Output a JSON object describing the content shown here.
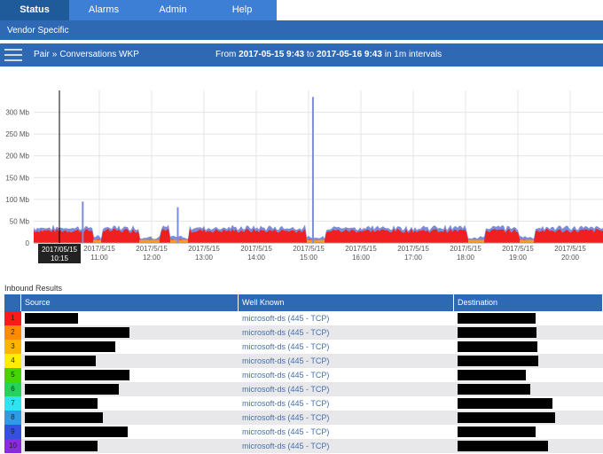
{
  "nav": {
    "tabs": [
      {
        "label": "Status",
        "active": true
      },
      {
        "label": "Alarms",
        "active": false
      },
      {
        "label": "Admin",
        "active": false
      },
      {
        "label": "Help",
        "active": false
      }
    ]
  },
  "vendor_bar": {
    "label": "Vendor Specific"
  },
  "path_bar": {
    "crumb_1": "Pair",
    "separator": "»",
    "crumb_2": "Conversations WKP",
    "range_from_prefix": "From",
    "range_from": "2017-05-15 9:43",
    "range_to_prefix": "to",
    "range_to": "2017-05-16 9:43",
    "range_interval": "in 1m intervals"
  },
  "chart_data": {
    "type": "area",
    "title": "",
    "xlabel": "",
    "ylabel": "",
    "y_unit": "Mb",
    "ylim": [
      0,
      350
    ],
    "y_ticks": [
      0,
      50,
      100,
      150,
      200,
      250,
      300
    ],
    "y_tick_labels": [
      "0",
      "50 Mb",
      "100 Mb",
      "150 Mb",
      "200 Mb",
      "250 Mb",
      "300 Mb"
    ],
    "x_ticks": [
      {
        "date": "2017/5/15",
        "time": "11:00"
      },
      {
        "date": "2017/5/15",
        "time": "12:00"
      },
      {
        "date": "2017/5/15",
        "time": "13:00"
      },
      {
        "date": "2017/5/15",
        "time": "14:00"
      },
      {
        "date": "2017/5/15",
        "time": "15:00"
      },
      {
        "date": "2017/5/15",
        "time": "16:00"
      },
      {
        "date": "2017/5/15",
        "time": "17:00"
      },
      {
        "date": "2017/5/15",
        "time": "18:00"
      },
      {
        "date": "2017/5/15",
        "time": "19:00"
      },
      {
        "date": "2017/5/15",
        "time": "20:00"
      }
    ],
    "cursor_label": {
      "date": "2017/05/15",
      "time": "10:15"
    },
    "grid": true,
    "series_colors": [
      "#f02020",
      "#ff9a1a",
      "#e8c000",
      "#3aa0e0",
      "#7c8cd8"
    ],
    "base_value_approx": 28,
    "spikes": [
      {
        "time": "10:41",
        "value": 95
      },
      {
        "time": "12:30",
        "value": 82
      },
      {
        "time": "15:05",
        "value": 335
      }
    ]
  },
  "results": {
    "title": "Inbound Results",
    "columns": [
      "Source",
      "Well Known",
      "Destination"
    ],
    "rows": [
      {
        "rank": "1",
        "color": "#ff1a1a",
        "well_known": "microsoft-ds (445 - TCP)"
      },
      {
        "rank": "2",
        "color": "#ff8a00",
        "well_known": "microsoft-ds (445 - TCP)"
      },
      {
        "rank": "3",
        "color": "#ffb400",
        "well_known": "microsoft-ds (445 - TCP)"
      },
      {
        "rank": "4",
        "color": "#ffee00",
        "well_known": "microsoft-ds (445 - TCP)"
      },
      {
        "rank": "5",
        "color": "#44d400",
        "well_known": "microsoft-ds (445 - TCP)"
      },
      {
        "rank": "6",
        "color": "#27d25a",
        "well_known": "microsoft-ds (445 - TCP)"
      },
      {
        "rank": "7",
        "color": "#2fe4f0",
        "well_known": "microsoft-ds (445 - TCP)"
      },
      {
        "rank": "8",
        "color": "#2f9ae6",
        "well_known": "microsoft-ds (445 - TCP)"
      },
      {
        "rank": "9",
        "color": "#3350e0",
        "well_known": "microsoft-ds (445 - TCP)"
      },
      {
        "rank": "10",
        "color": "#8a2be2",
        "well_known": "microsoft-ds (445 - TCP)"
      }
    ]
  }
}
